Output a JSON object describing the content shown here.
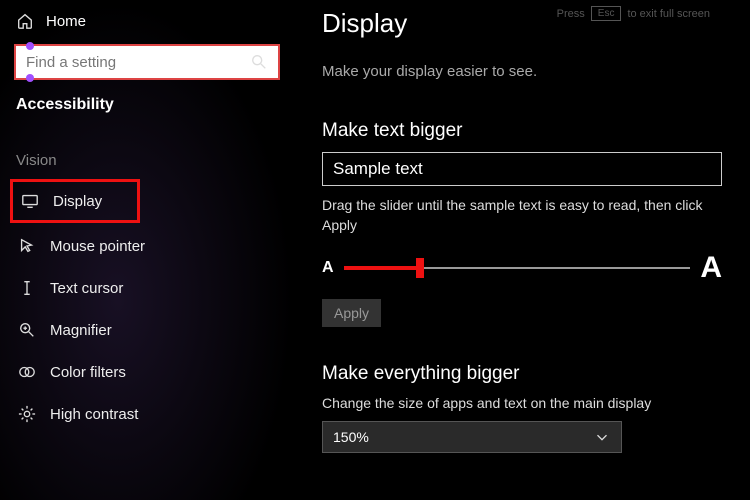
{
  "sidebar": {
    "home_label": "Home",
    "search_placeholder": "Find a setting",
    "section": "Accessibility",
    "group": "Vision",
    "items": [
      {
        "label": "Display"
      },
      {
        "label": "Mouse pointer"
      },
      {
        "label": "Text cursor"
      },
      {
        "label": "Magnifier"
      },
      {
        "label": "Color filters"
      },
      {
        "label": "High contrast"
      }
    ]
  },
  "fullscreen_hint": {
    "before": "Press",
    "key": "Esc",
    "after": "to exit full screen"
  },
  "main": {
    "title": "Display",
    "subtitle": "Make your display easier to see.",
    "text_section": {
      "heading": "Make text bigger",
      "sample": "Sample text",
      "hint": "Drag the slider until the sample text is easy to read, then click Apply",
      "letter_small": "A",
      "letter_big": "A",
      "apply_label": "Apply"
    },
    "scale_section": {
      "heading": "Make everything bigger",
      "desc": "Change the size of apps and text on the main display",
      "value": "150%"
    }
  }
}
